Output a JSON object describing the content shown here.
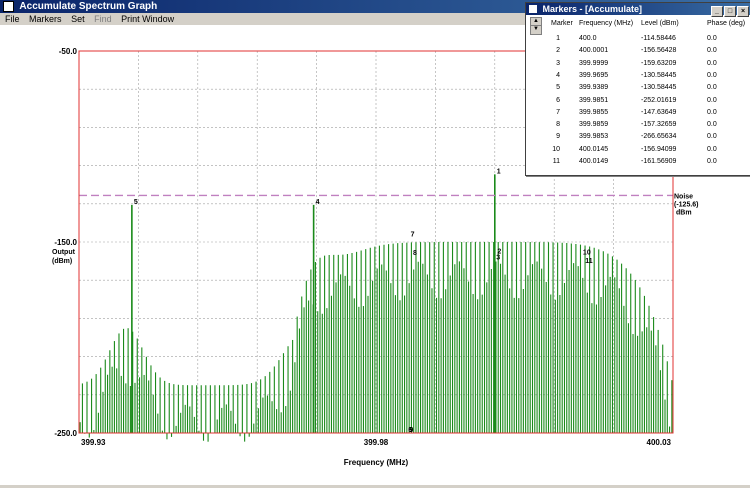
{
  "window": {
    "title": "Accumulate Spectrum Graph"
  },
  "menu": {
    "file": "File",
    "markers": "Markers",
    "set": "Set",
    "find": "Find",
    "print": "Print Window"
  },
  "chart_data": {
    "type": "bar",
    "x_axis": {
      "label": "Frequency (MHz)",
      "range": [
        399.93,
        400.03
      ],
      "ticks": [
        "399.93",
        "399.98",
        "400.03"
      ]
    },
    "y_axis": {
      "label_line1": "Output",
      "label_line2": "(dBm)",
      "range": [
        -250.0,
        -50.0
      ],
      "ticks": [
        "-50.0",
        "-150.0",
        "-250.0"
      ]
    },
    "noise": {
      "level": -125.6,
      "label_line1": "Noise",
      "label_line2": "(-125.6)",
      "label_line3": "dBm"
    },
    "grid": true,
    "colors": {
      "spectrum": "#1a8a1a",
      "border": "#e03030",
      "noise": "#c080c0",
      "grid": "#a0a0a0"
    },
    "markers": [
      {
        "label": "1",
        "freq": 400.0,
        "level": -114.58446
      },
      {
        "label": "2",
        "freq": 400.0001,
        "level": -156.56428
      },
      {
        "label": "3",
        "freq": 399.9999,
        "level": -159.63209
      },
      {
        "label": "4",
        "freq": 399.9695,
        "level": -130.58445
      },
      {
        "label": "5",
        "freq": 399.9389,
        "level": -130.58445
      },
      {
        "label": "6",
        "freq": 399.9851,
        "level": -252.01619
      },
      {
        "label": "7",
        "freq": 399.9855,
        "level": -147.63649
      },
      {
        "label": "8",
        "freq": 399.9859,
        "level": -157.32659
      },
      {
        "label": "9",
        "freq": 399.9853,
        "level": -266.65634
      },
      {
        "label": "10",
        "freq": 400.0145,
        "level": -156.94099
      },
      {
        "label": "11",
        "freq": 400.0149,
        "level": -161.56909
      }
    ]
  },
  "markers_window": {
    "title": "Markers - [Accumulate]",
    "headers": [
      "Marker",
      "Frequency (MHz)",
      "Level (dBm)",
      "Phase (deg)"
    ],
    "rows": [
      [
        "1",
        "400.0",
        "-114.58446",
        "0.0"
      ],
      [
        "2",
        "400.0001",
        "-156.56428",
        "0.0"
      ],
      [
        "3",
        "399.9999",
        "-159.63209",
        "0.0"
      ],
      [
        "4",
        "399.9695",
        "-130.58445",
        "0.0"
      ],
      [
        "5",
        "399.9389",
        "-130.58445",
        "0.0"
      ],
      [
        "6",
        "399.9851",
        "-252.01619",
        "0.0"
      ],
      [
        "7",
        "399.9855",
        "-147.63649",
        "0.0"
      ],
      [
        "8",
        "399.9859",
        "-157.32659",
        "0.0"
      ],
      [
        "9",
        "399.9853",
        "-266.65634",
        "0.0"
      ],
      [
        "10",
        "400.0145",
        "-156.94099",
        "0.0"
      ],
      [
        "11",
        "400.0149",
        "-161.56909",
        "0.0"
      ]
    ]
  }
}
